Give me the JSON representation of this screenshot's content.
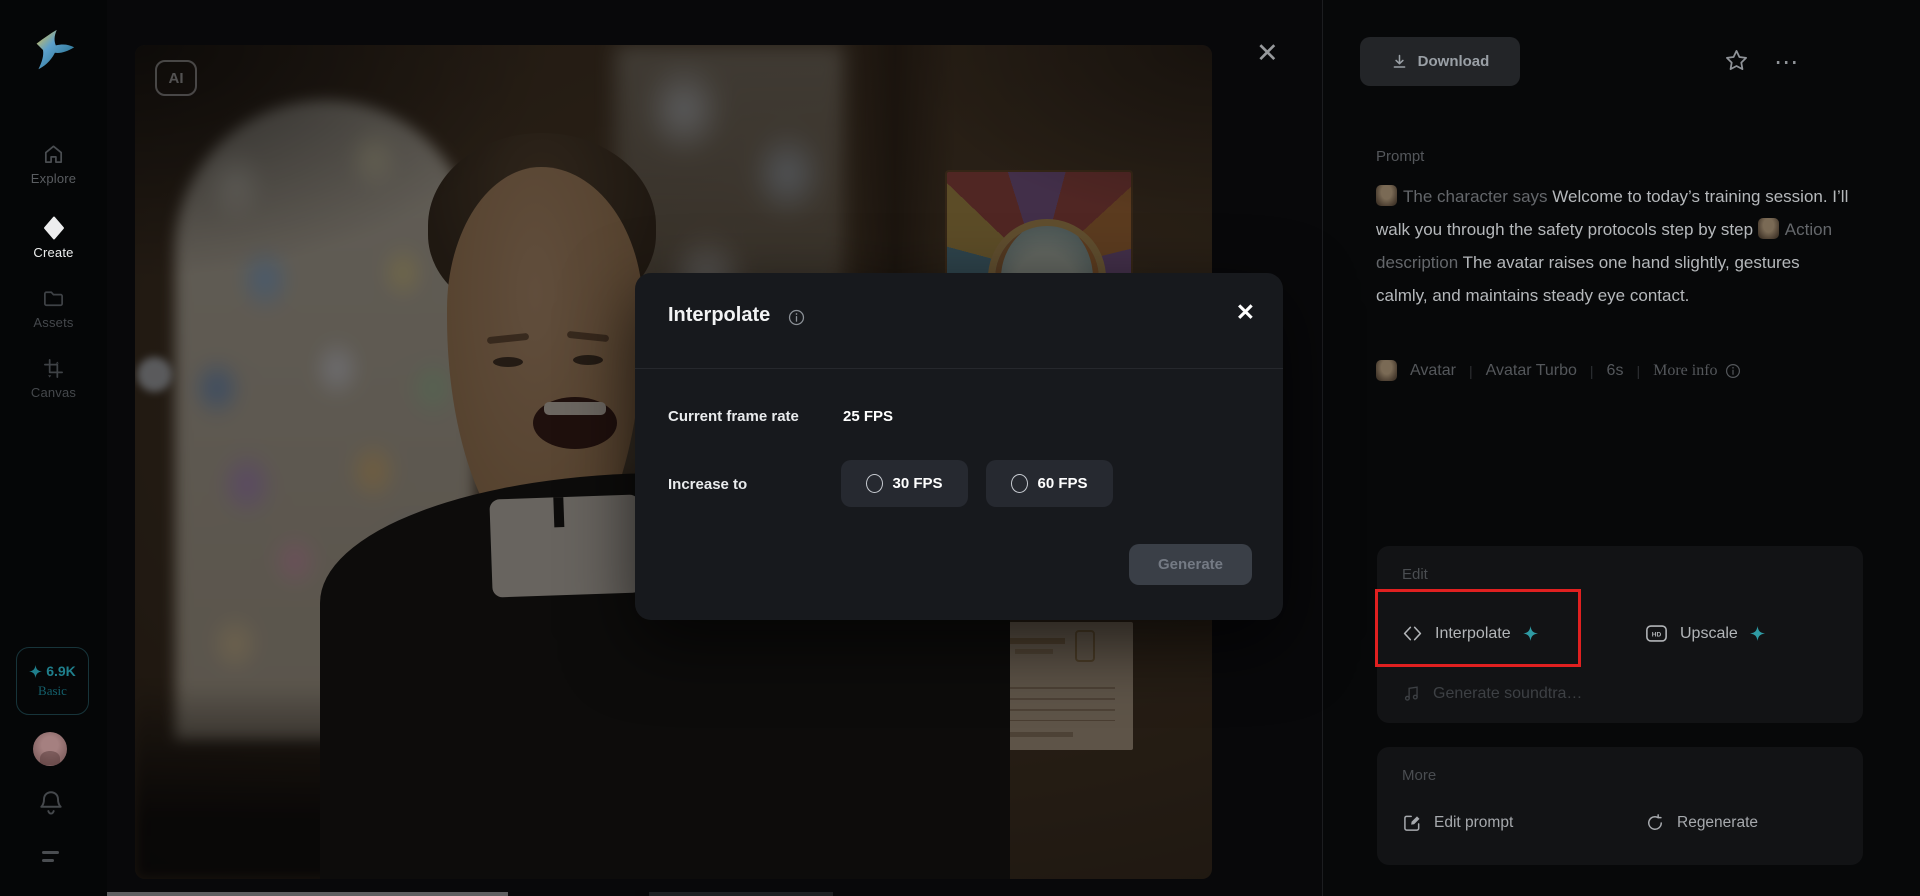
{
  "sidebar": {
    "items": [
      {
        "label": "Explore"
      },
      {
        "label": "Create"
      },
      {
        "label": "Assets"
      },
      {
        "label": "Canvas"
      }
    ],
    "credits": {
      "amount": "6.9K",
      "plan": "Basic"
    }
  },
  "viewer": {
    "ai_badge": "AI",
    "close": "✕"
  },
  "modal": {
    "title": "Interpolate",
    "close": "✕",
    "current_frame_rate_label": "Current frame rate",
    "current_frame_rate_value": "25 FPS",
    "increase_to_label": "Increase to",
    "options": [
      {
        "label": "30 FPS"
      },
      {
        "label": "60 FPS"
      }
    ],
    "generate_label": "Generate"
  },
  "panel": {
    "download_label": "Download",
    "more_menu": "⋯",
    "prompt": {
      "label": "Prompt",
      "segments": [
        {
          "kind": "tag",
          "text": "The character says"
        },
        {
          "kind": "text",
          "text": "Welcome to today’s training session. I’ll walk you through the safety protocols step by step"
        },
        {
          "kind": "tag",
          "text": "Action description"
        },
        {
          "kind": "text",
          "text": "The avatar raises one hand slightly, gestures calmly, and maintains steady eye contact."
        }
      ]
    },
    "meta": {
      "model": "Avatar",
      "engine": "Avatar Turbo",
      "duration": "6s",
      "more_info": "More info",
      "separator": "|"
    },
    "edit_card": {
      "title": "Edit",
      "interpolate": "Interpolate",
      "upscale": "Upscale",
      "hd": "HD",
      "generate_soundtrack": "Generate soundtra…"
    },
    "more_card": {
      "title": "More",
      "edit_prompt": "Edit prompt",
      "regenerate": "Regenerate"
    }
  },
  "colors": {
    "accent_teal": "#2f9ba4",
    "annotation_red": "#e02020"
  }
}
